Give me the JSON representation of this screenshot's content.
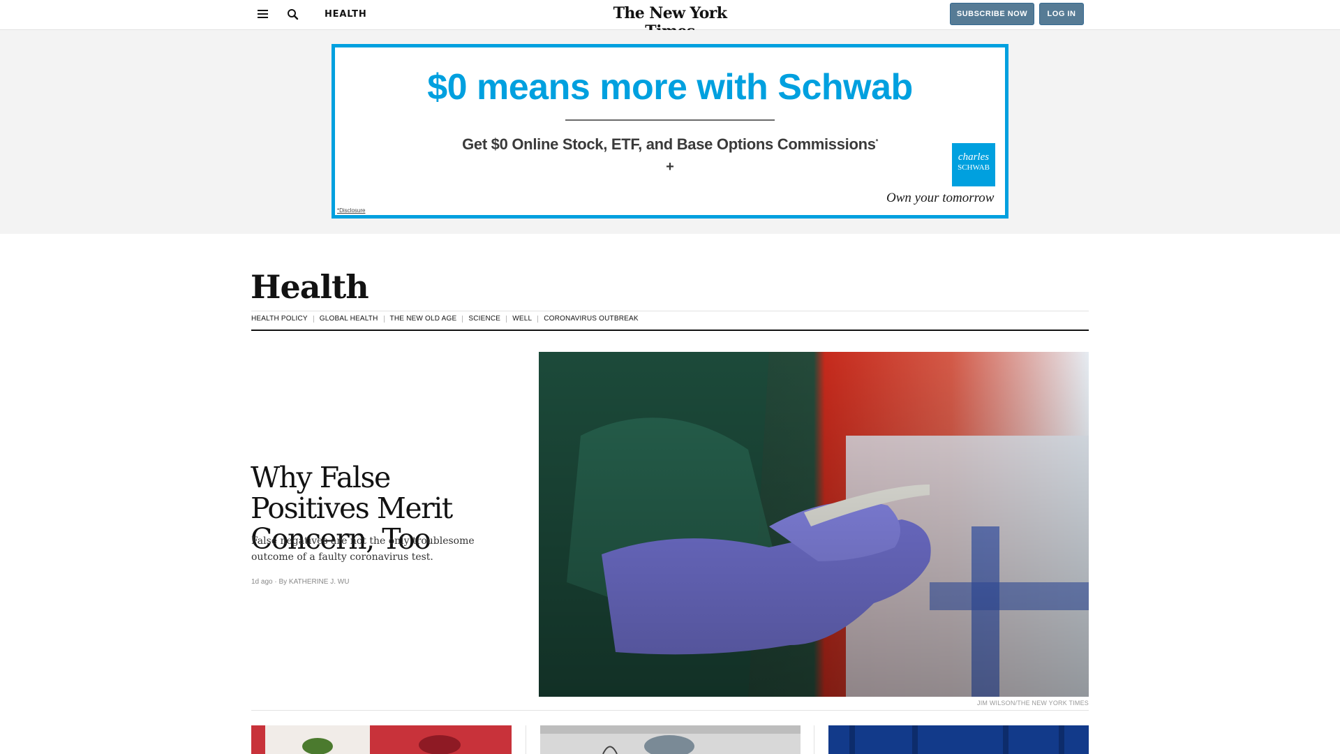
{
  "header": {
    "section_label": "HEALTH",
    "masthead": "The New York Times",
    "subscribe_label": "SUBSCRIBE NOW",
    "login_label": "LOG IN",
    "menu_icon": "hamburger-menu-icon",
    "search_icon": "search-icon"
  },
  "ad": {
    "headline": "$0 means more with Schwab",
    "subheadline": "Get $0 Online Stock, ETF, and Base Options Commissions",
    "subheadline_mark": "*",
    "plus": "+",
    "logo_line1": "charles",
    "logo_line2": "SCHWAB",
    "tagline": "Own your tomorrow",
    "disclosure": "*Disclosure",
    "brand_color": "#00a0df"
  },
  "section": {
    "title": "Health",
    "subnav": [
      "HEALTH POLICY",
      "GLOBAL HEALTH",
      "THE NEW OLD AGE",
      "SCIENCE",
      "WELL",
      "CORONAVIRUS OUTBREAK"
    ]
  },
  "lead": {
    "headline": "Why False Positives Merit Concern, Too",
    "summary": "False negatives are not the only troublesome outcome of a faulty coronavirus test.",
    "time": "1d ago",
    "byline": "By KATHERINE J. WU",
    "image_credit": "JIM WILSON/THE NEW YORK TIMES"
  },
  "colors": {
    "button_bg": "#567b95",
    "rule": "#121212"
  }
}
